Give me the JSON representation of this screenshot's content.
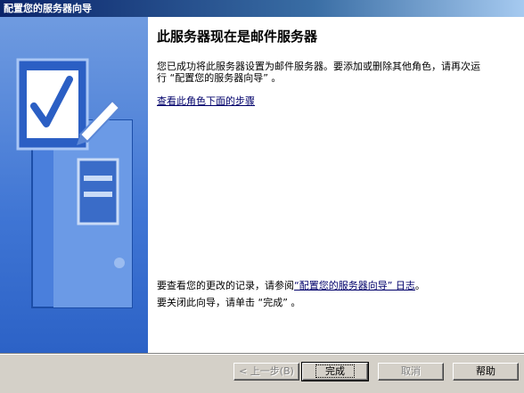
{
  "window": {
    "title": "配置您的服务器向导"
  },
  "main": {
    "heading": "此服务器现在是邮件服务器",
    "paragraph": "您已成功将此服务器设置为邮件服务器。要添加或删除其他角色，请再次运行 “配置您的服务器向导” 。",
    "link_steps": "查看此角色下面的步骤",
    "log_prefix": "要查看您的更改的记录，请参阅",
    "log_link": "“配置您的服务器向导” 日志",
    "log_suffix": "。",
    "close_text": "要关闭此向导，请单击 “完成” 。"
  },
  "buttons": {
    "back": "< 上一步(B)",
    "finish": "完成",
    "cancel": "取消",
    "help": "帮助"
  },
  "colors": {
    "titlebar_start": "#0a246a",
    "banner_blue": "#3f75d4",
    "link": "#00006a"
  }
}
